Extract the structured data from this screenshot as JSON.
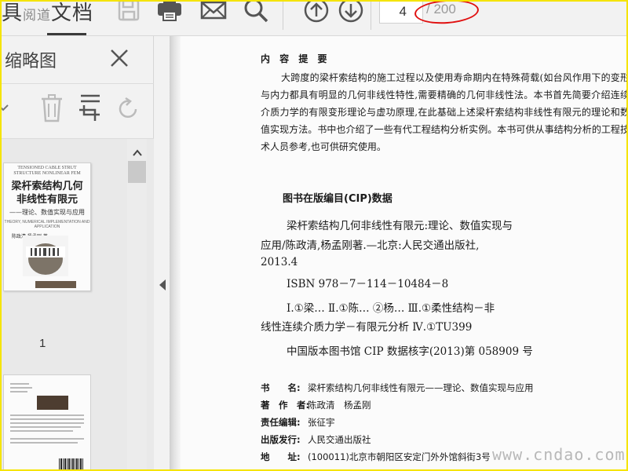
{
  "app": {
    "title_left": "具",
    "title_faded": "阅道",
    "title_right": "文档"
  },
  "toolbar": {
    "icons": [
      "save-icon",
      "print-icon",
      "mail-icon",
      "search-icon",
      "arrow-up-icon",
      "arrow-down-icon"
    ],
    "page_current": "4",
    "page_total": "/ 200"
  },
  "sidebar": {
    "title": "缩略图",
    "close": "close-icon",
    "tools": [
      "chevron-icon",
      "delete-icon",
      "crop-icon",
      "rotate-icon"
    ],
    "thumb1_label": "1",
    "cover": {
      "small_header": "TENSIONED CABLE STRUT STRUCTURE NONLINEAR FEM",
      "title_line1": "梁杆索结构几何",
      "title_line2": "非线性有限元",
      "subtitle": "——理论、数值实现与应用",
      "english": "THEORY, NUMERICAL IMPLEMENTATION AND APPLICATION",
      "authors": "陈政清  杨孟刚 著"
    }
  },
  "document": {
    "summary_heading": "内 容 提 要",
    "summary_text": "大跨度的梁杆索结构的施工过程以及使用寿命期内在特殊荷载(如台风作用下的变形与内力都具有明显的几何非线性特性,需要精确的几何非线性法。本书首先简要介绍连续介质力学的有限变形理论与虚功原理,在此基础上述梁杆索结构非线性有限元的理论和数值实现方法。书中也介绍了一些有代工程结构分析实例。本书可供从事结构分析的工程技术人员参考,也可供研究使用。",
    "cip_heading": "图书在版编目(CIP)数据",
    "cip_lines": [
      "梁杆索结构几何非线性有限元:理论、数值实现与",
      "应用/陈政清,杨孟刚著.—北京:人民交通出版社,",
      "2013.4",
      "ISBN 978－7－114－10484－8",
      "Ⅰ.①梁… Ⅱ.①陈… ②杨… Ⅲ.①柔性结构－非",
      "线性连续介质力学－有限元分析 Ⅳ.①TU399",
      "中国版本图书馆 CIP 数据核字(2013)第 058909 号"
    ],
    "info": [
      {
        "key": "书　　名:",
        "value": "梁杆索结构几何非线性有限元——理论、数值实现与应用"
      },
      {
        "key": "著　作　者:",
        "value": "陈政清　杨孟刚"
      },
      {
        "key": "责任编辑:",
        "value": "张征宇"
      },
      {
        "key": "出版发行:",
        "value": "人民交通出版社"
      },
      {
        "key": "地　　址:",
        "value": "(100011)北京市朝阳区安定门外外馆斜街3号"
      }
    ],
    "watermark": "www.cndao.com"
  },
  "colors": {
    "annotation_circle": "#e01010",
    "frame": "#f5e400",
    "toolbar_bg": "#f2f2f2"
  }
}
